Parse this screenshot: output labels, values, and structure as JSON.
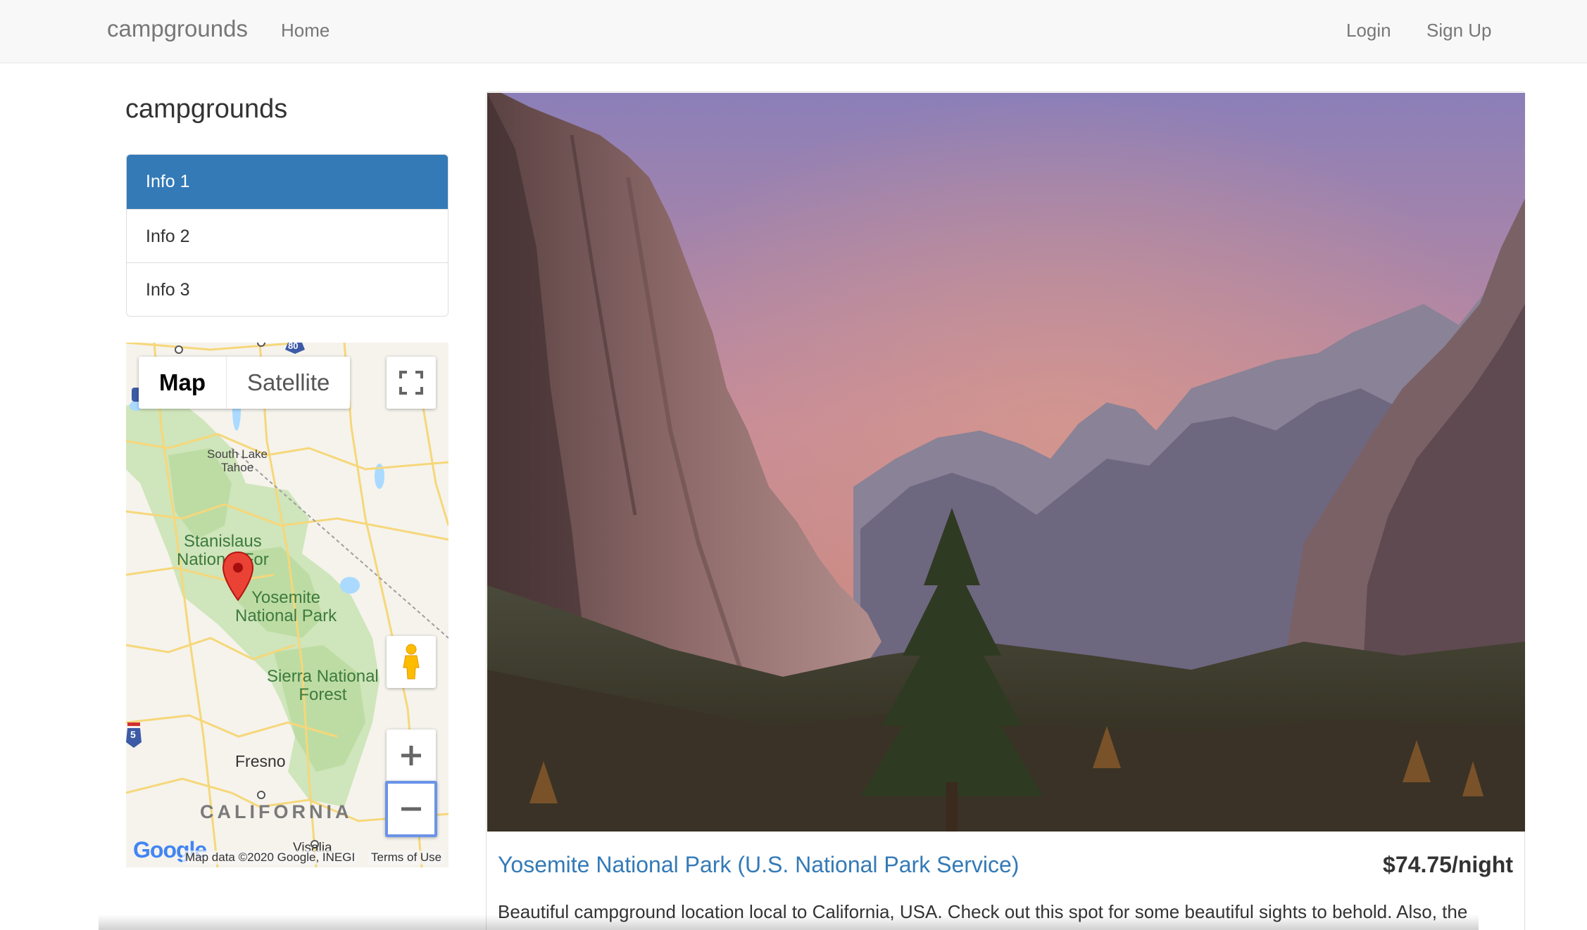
{
  "navbar": {
    "brand": "campgrounds",
    "home": "Home",
    "login": "Login",
    "signup": "Sign Up"
  },
  "sidebar": {
    "title": "campgrounds",
    "items": [
      {
        "label": "Info 1",
        "active": true
      },
      {
        "label": "Info 2",
        "active": false
      },
      {
        "label": "Info 3",
        "active": false
      }
    ]
  },
  "map": {
    "type_buttons": {
      "map": "Map",
      "satellite": "Satellite"
    },
    "labels": {
      "south_lake_tahoe_1": "South Lake",
      "south_lake_tahoe_2": "Tahoe",
      "stanislaus_1": "Stanislaus",
      "stanislaus_2": "National For",
      "yosemite_1": "Yosemite",
      "yosemite_2": "National Park",
      "sierra_1": "Sierra National",
      "sierra_2": "Forest",
      "fresno": "Fresno",
      "california": "CALIFORNIA",
      "visalia": "Visalia"
    },
    "highway_80": "80",
    "highway_5": "5",
    "google_logo": "Google",
    "attribution": "Map data ©2020 Google, INEGI",
    "terms": "Terms of Use",
    "icons": [
      "fullscreen-icon",
      "pegman-icon",
      "zoom-in-icon",
      "zoom-out-icon",
      "map-marker-icon"
    ]
  },
  "campground": {
    "name": "Yosemite National Park (U.S. National Park Service)",
    "price": "$74.75/night",
    "description": "Beautiful campground location local to California, USA. Check out this spot for some beautiful sights to behold. Also, the mascot"
  },
  "colors": {
    "accent": "#337ab7",
    "navbar_bg": "#f8f8f8",
    "marker": "#ea4335",
    "forest": "#c8e2b1"
  }
}
